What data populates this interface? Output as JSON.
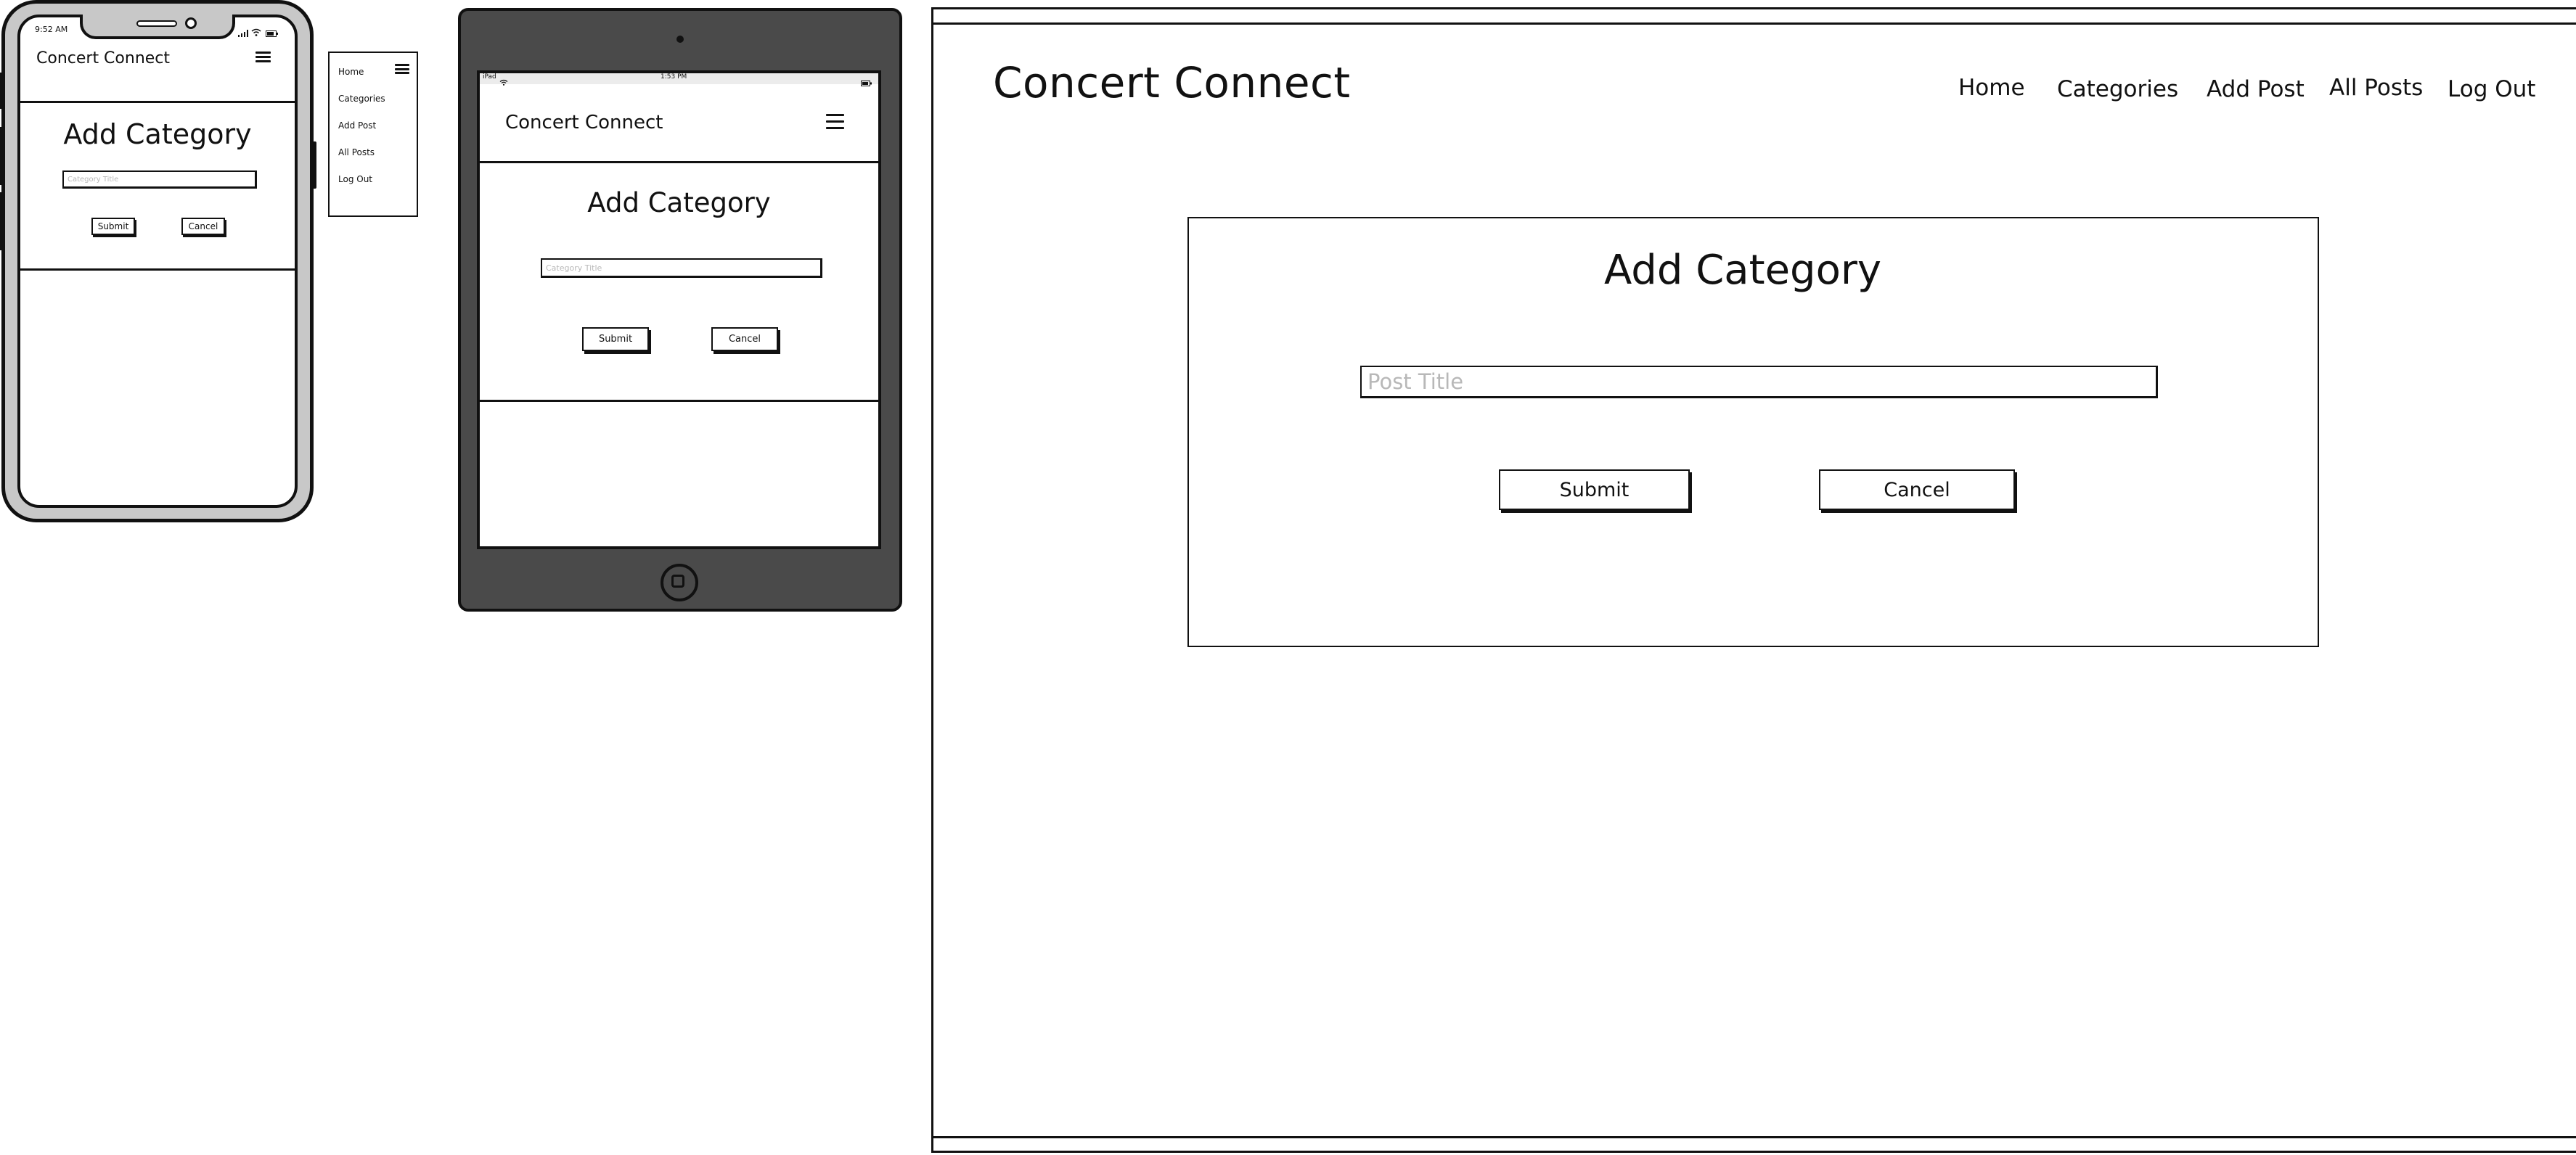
{
  "app": {
    "brand": "Concert Connect",
    "page_title": "Add Category"
  },
  "phone": {
    "status_time": "9:52 AM",
    "brand": "Concert Connect",
    "heading": "Add Category",
    "input_placeholder": "Category Title",
    "submit_label": "Submit",
    "cancel_label": "Cancel"
  },
  "mobile_menu": {
    "items": [
      {
        "label": "Home"
      },
      {
        "label": "Categories"
      },
      {
        "label": "Add Post"
      },
      {
        "label": "All Posts"
      },
      {
        "label": "Log Out"
      }
    ]
  },
  "tablet": {
    "status_carrier": "iPad",
    "status_time": "1:53 PM",
    "brand": "Concert Connect",
    "heading": "Add Category",
    "input_placeholder": "Category Title",
    "submit_label": "Submit",
    "cancel_label": "Cancel"
  },
  "desktop": {
    "brand": "Concert Connect",
    "nav": [
      {
        "label": "Home"
      },
      {
        "label": "Categories"
      },
      {
        "label": "Add Post"
      },
      {
        "label": "All Posts"
      },
      {
        "label": "Log Out"
      }
    ],
    "heading": "Add Category",
    "input_placeholder": "Post Title",
    "submit_label": "Submit",
    "cancel_label": "Cancel"
  }
}
